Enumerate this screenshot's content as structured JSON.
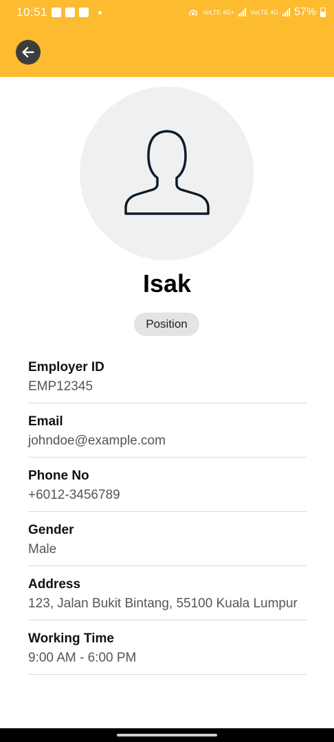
{
  "status_bar": {
    "time": "10:51",
    "network_1": "VoLTE 4G+",
    "network_2": "VoLTE 4G",
    "battery": "57%"
  },
  "app_bar": {
    "back_icon": "arrow-left-icon",
    "accent_color": "#FDBB30"
  },
  "profile": {
    "avatar_icon": "person-outline-icon",
    "name": "Isak",
    "position": "Position"
  },
  "fields": [
    {
      "label": "Employer ID",
      "value": "EMP12345"
    },
    {
      "label": "Email",
      "value": "johndoe@example.com"
    },
    {
      "label": "Phone No",
      "value": "+6012-3456789"
    },
    {
      "label": "Gender",
      "value": "Male"
    },
    {
      "label": "Address",
      "value": "123, Jalan Bukit Bintang, 55100 Kuala Lumpur"
    },
    {
      "label": "Working Time",
      "value": "9:00 AM - 6:00 PM"
    }
  ]
}
